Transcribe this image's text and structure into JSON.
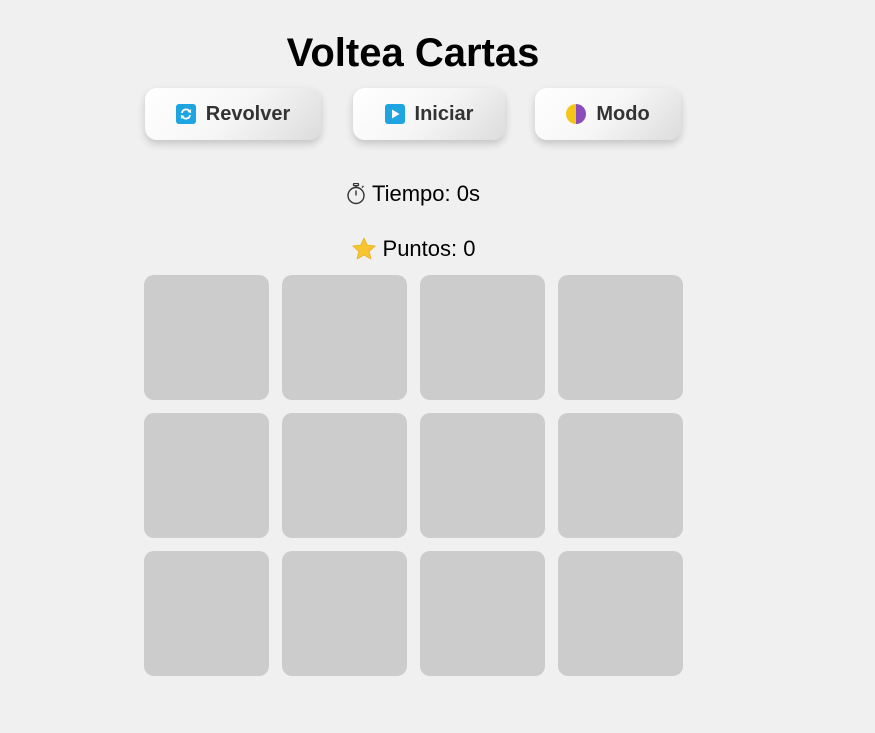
{
  "title": "Voltea Cartas",
  "buttons": {
    "shuffle": {
      "label": "Revolver",
      "icon": "shuffle-icon"
    },
    "start": {
      "label": "Iniciar",
      "icon": "play-icon"
    },
    "mode": {
      "label": "Modo",
      "icon": "contrast-icon"
    }
  },
  "stats": {
    "time_label": "Tiempo: 0s",
    "time_icon": "stopwatch-icon",
    "points_label": "Puntos: 0",
    "points_icon": "star-icon"
  },
  "colors": {
    "background": "#f0f0f0",
    "card": "#cccccc",
    "icon_blue": "#1ea4e0",
    "star": "#f7c531"
  },
  "cards": [
    {
      "id": 1
    },
    {
      "id": 2
    },
    {
      "id": 3
    },
    {
      "id": 4
    },
    {
      "id": 5
    },
    {
      "id": 6
    },
    {
      "id": 7
    },
    {
      "id": 8
    },
    {
      "id": 9
    },
    {
      "id": 10
    },
    {
      "id": 11
    },
    {
      "id": 12
    }
  ]
}
